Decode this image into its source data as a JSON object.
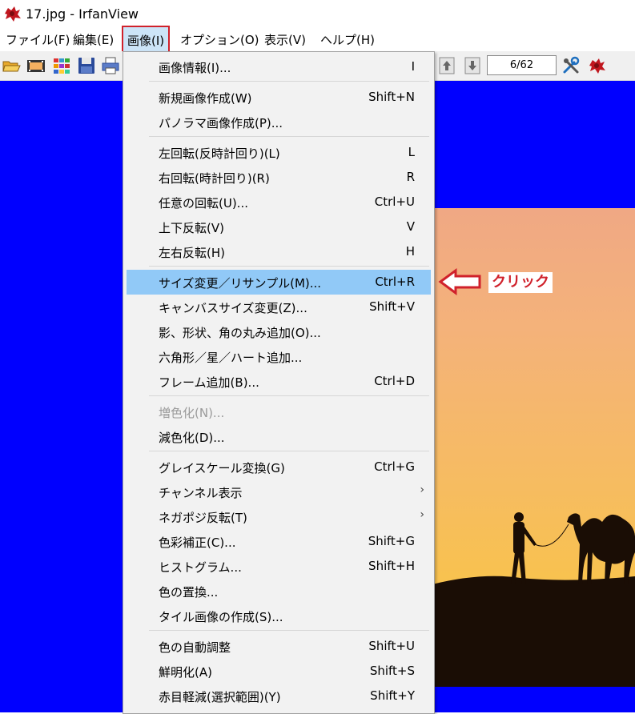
{
  "window": {
    "title": "17.jpg - IrfanView"
  },
  "menubar": {
    "items": [
      {
        "label": "ファイル(F)"
      },
      {
        "label": "編集(E)"
      },
      {
        "label": "画像(I)"
      },
      {
        "label": "オプション(O)"
      },
      {
        "label": "表示(V)"
      },
      {
        "label": "ヘルプ(H)"
      }
    ],
    "active_index": 2
  },
  "toolbar": {
    "page_counter": "6/62",
    "icons": [
      "open-folder-icon",
      "slideshow-icon",
      "thumbnails-icon",
      "save-icon",
      "print-icon",
      "prev-page-icon",
      "next-page-icon",
      "settings-icon",
      "irfan-logo-icon"
    ]
  },
  "image_menu": {
    "items": [
      {
        "label": "画像情報(I)...",
        "shortcut": "I"
      },
      {
        "label": "新規画像作成(W)",
        "shortcut": "Shift+N"
      },
      {
        "label": "パノラマ画像作成(P)...",
        "shortcut": ""
      },
      {
        "label": "左回転(反時計回り)(L)",
        "shortcut": "L"
      },
      {
        "label": "右回転(時計回り)(R)",
        "shortcut": "R"
      },
      {
        "label": "任意の回転(U)...",
        "shortcut": "Ctrl+U"
      },
      {
        "label": "上下反転(V)",
        "shortcut": "V"
      },
      {
        "label": "左右反転(H)",
        "shortcut": "H"
      },
      {
        "label": "サイズ変更／リサンプル(M)...",
        "shortcut": "Ctrl+R"
      },
      {
        "label": "キャンバスサイズ変更(Z)...",
        "shortcut": "Shift+V"
      },
      {
        "label": "影、形状、角の丸み追加(O)...",
        "shortcut": ""
      },
      {
        "label": "六角形／星／ハート追加...",
        "shortcut": ""
      },
      {
        "label": "フレーム追加(B)...",
        "shortcut": "Ctrl+D"
      },
      {
        "label": "増色化(N)...",
        "shortcut": ""
      },
      {
        "label": "減色化(D)...",
        "shortcut": ""
      },
      {
        "label": "グレイスケール変換(G)",
        "shortcut": "Ctrl+G"
      },
      {
        "label": "チャンネル表示",
        "shortcut": ""
      },
      {
        "label": "ネガポジ反転(T)",
        "shortcut": ""
      },
      {
        "label": "色彩補正(C)...",
        "shortcut": "Shift+G"
      },
      {
        "label": "ヒストグラム...",
        "shortcut": "Shift+H"
      },
      {
        "label": "色の置換...",
        "shortcut": ""
      },
      {
        "label": "タイル画像の作成(S)...",
        "shortcut": ""
      },
      {
        "label": "色の自動調整",
        "shortcut": "Shift+U"
      },
      {
        "label": "鮮明化(A)",
        "shortcut": "Shift+S"
      },
      {
        "label": "赤目軽減(選択範囲)(Y)",
        "shortcut": "Shift+Y"
      }
    ],
    "highlighted_index": 8,
    "disabled_indices": [
      13
    ],
    "submenu_indices": [
      16,
      17
    ]
  },
  "annotation": {
    "label": "クリック",
    "color": "#d0212b"
  },
  "colors": {
    "canvas_background": "#0000ff",
    "highlight": "#91c9f7",
    "accent_red": "#d0212b"
  }
}
